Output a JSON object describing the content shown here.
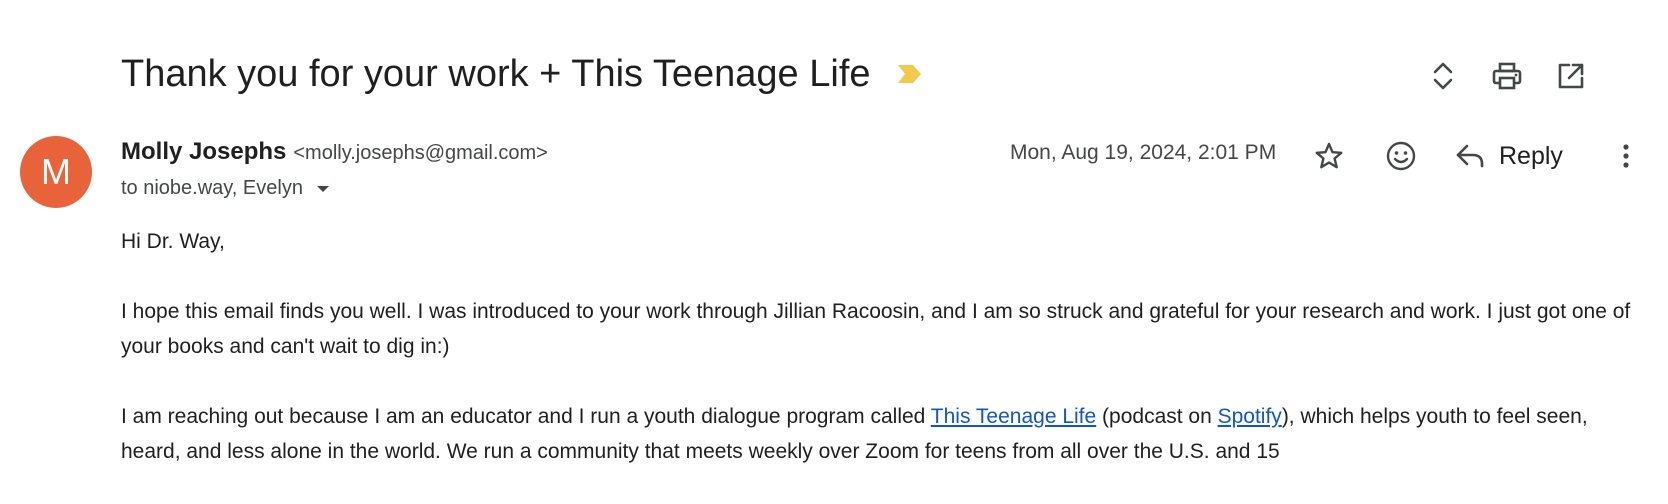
{
  "email": {
    "subject": "Thank you for your work + This Teenage Life",
    "sender": {
      "name": "Molly Josephs",
      "email": "<molly.josephs@gmail.com>",
      "avatar_initial": "M",
      "avatar_color": "#e8623a"
    },
    "recipients": "to niobe.way, Evelyn",
    "date": "Mon, Aug 19, 2024, 2:01 PM",
    "actions": {
      "reply_label": "Reply"
    },
    "body": {
      "greeting": "Hi Dr. Way,",
      "paragraph1": "I hope this email finds you well. I was introduced to your work through Jillian Racoosin, and I am so struck and grateful for your research and work. I just got one of your books and can't wait to dig in:)",
      "paragraph2": {
        "part1": "I am reaching out because I am an educator and I run a youth dialogue program called ",
        "link1": "This Teenage Life",
        "part2": " (podcast on ",
        "link2": "Spotify",
        "part3": "), which helps youth to feel seen, heard, and less alone in the world. We run a community that meets weekly over Zoom for teens from all over the U.S. and 15"
      }
    }
  },
  "icons": {
    "important_marker": "important-marker-icon",
    "expand": "unfold-icon",
    "print": "print-icon",
    "open_new_window": "open-in-new-icon",
    "star": "star-icon",
    "emoji": "emoji-icon",
    "reply": "reply-icon",
    "more": "more-vert-icon",
    "caret": "caret-down-icon"
  },
  "colors": {
    "link": "#1155cc",
    "important_marker": "#f2c94c",
    "secondary_text": "#444746"
  }
}
